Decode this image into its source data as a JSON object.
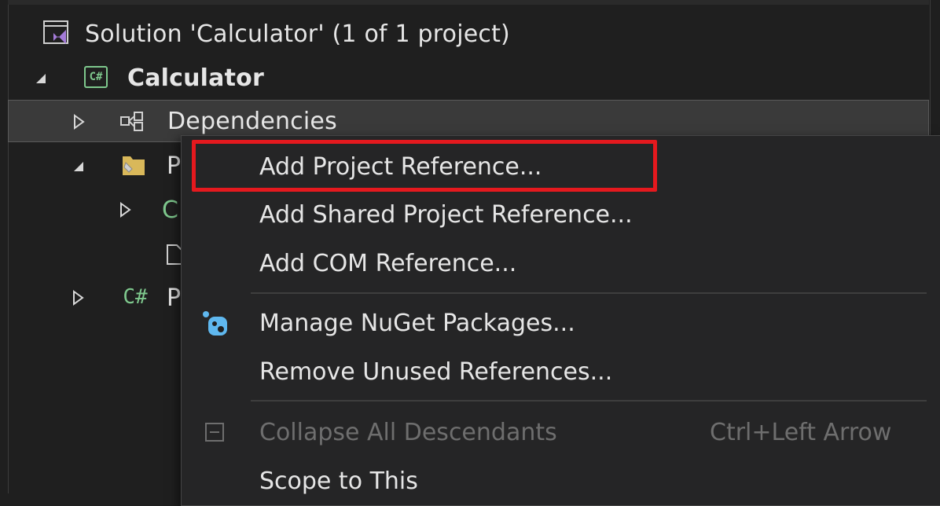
{
  "tree": {
    "solution_label": "Solution 'Calculator' (1 of 1 project)",
    "project_label": "Calculator",
    "dependencies_label": "Dependencies",
    "properties_partial": "P",
    "child_partial": "C",
    "program_partial": "P"
  },
  "context_menu": {
    "items": [
      {
        "label": "Add Project Reference..."
      },
      {
        "label": "Add Shared Project Reference..."
      },
      {
        "label": "Add COM Reference..."
      },
      {
        "label": "Manage NuGet Packages..."
      },
      {
        "label": "Remove Unused References..."
      },
      {
        "label": "Collapse All Descendants",
        "shortcut": "Ctrl+Left Arrow",
        "disabled": true
      },
      {
        "label": "Scope to This"
      }
    ]
  },
  "colors": {
    "highlight": "#e5191e",
    "csharp_green": "#7ec88d",
    "nuget_blue": "#5fb8ef",
    "vs_purple": "#a47bd8"
  }
}
